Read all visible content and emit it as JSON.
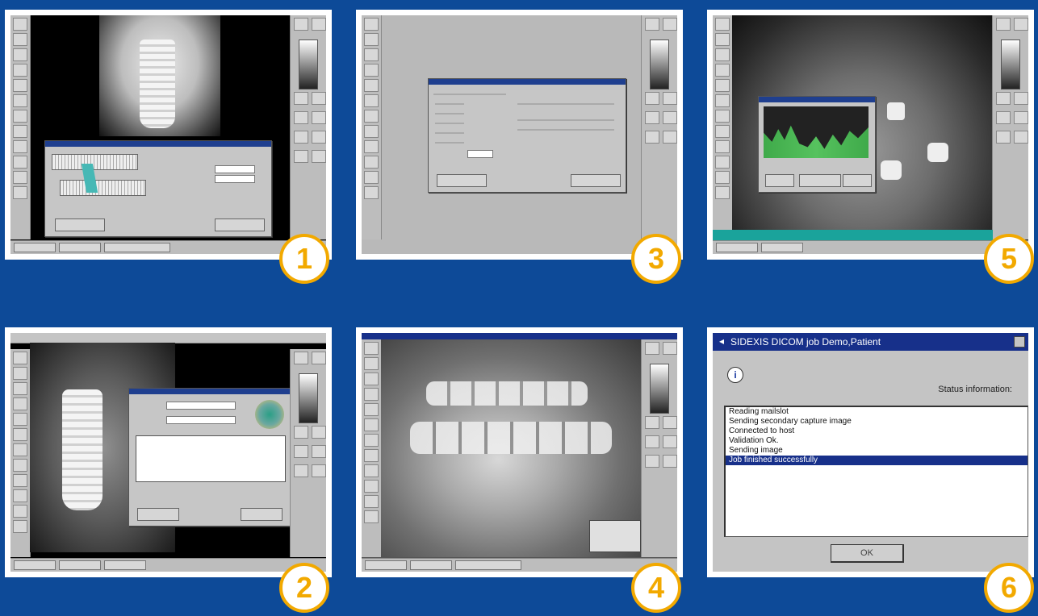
{
  "colors": {
    "background": "#0d4a98",
    "badge_ring": "#f2a900",
    "titlebar": "#17308a",
    "selection": "#17308a"
  },
  "panels": [
    {
      "id": "1",
      "badge": "1",
      "content": "implant-measurement-dialog"
    },
    {
      "id": "2",
      "badge": "2",
      "content": "implant-database-dialog"
    },
    {
      "id": "3",
      "badge": "3",
      "content": "settings-dialog"
    },
    {
      "id": "4",
      "badge": "4",
      "content": "jaw-xray-view"
    },
    {
      "id": "5",
      "badge": "5",
      "content": "panoramic-density-chart"
    },
    {
      "id": "6",
      "badge": "6",
      "content": "dicom-job-status"
    }
  ],
  "dialog6": {
    "title": "SIDEXIS DICOM job Demo,Patient",
    "status_label": "Status information:",
    "log": [
      "Reading mailslot",
      "Sending secondary capture image",
      "Connected to host",
      "Validation Ok.",
      "Sending image",
      "Job finished successfully"
    ],
    "selected_index": 5,
    "ok_label": "OK"
  }
}
